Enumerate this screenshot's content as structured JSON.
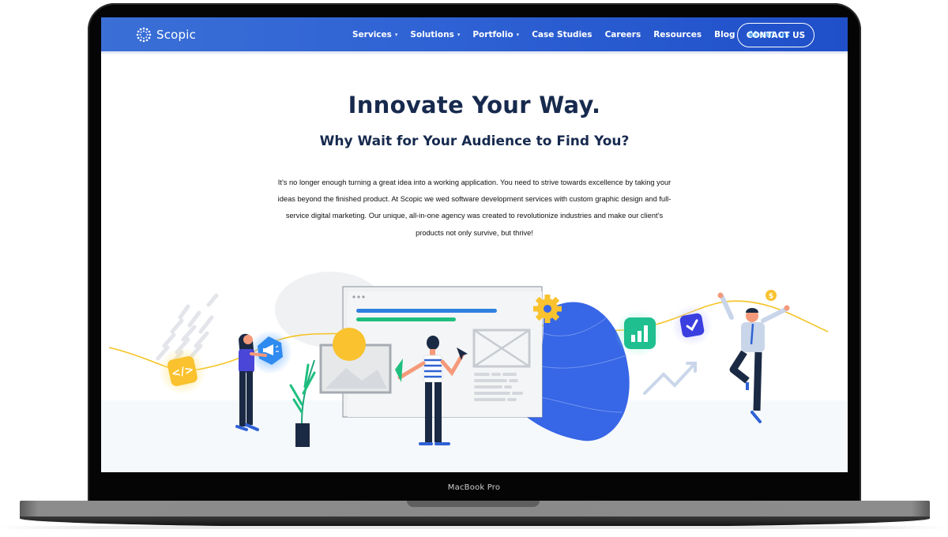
{
  "device": {
    "model_label": "MacBook Pro"
  },
  "navbar": {
    "brand": "Scopic",
    "items": [
      {
        "label": "Services",
        "has_dropdown": true,
        "chevron": "▾"
      },
      {
        "label": "Solutions",
        "has_dropdown": true,
        "chevron": "▾"
      },
      {
        "label": "Portfolio",
        "has_dropdown": true,
        "chevron": "▾"
      },
      {
        "label": "Case Studies",
        "has_dropdown": false
      },
      {
        "label": "Careers",
        "has_dropdown": false
      },
      {
        "label": "Resources",
        "has_dropdown": false
      },
      {
        "label": "Blog",
        "has_dropdown": false
      },
      {
        "label": "About us",
        "has_dropdown": false,
        "active": true
      }
    ],
    "cta_label": "CONTACT US",
    "colors": {
      "bar": "#2f62d4",
      "active_link": "#7fd0ff"
    }
  },
  "hero": {
    "title": "Innovate Your Way.",
    "subtitle": "Why Wait for Your Audience to Find You?",
    "body": "It’s no longer enough turning a great idea into a working application. You need to strive towards excellence by taking your ideas beyond the finished product. At Scopic we wed software development services with custom graphic design and full-service digital marketing. Our unique, all-in-one agency was created to revolutionize industries and make our client’s products not only survive, but thrive!"
  },
  "illustration": {
    "icons": [
      "code-icon",
      "megaphone-icon",
      "gear-icon",
      "bar-chart-icon",
      "checkmark-icon",
      "dollar-coin-icon",
      "trend-arrow-icon",
      "cursor-icon"
    ],
    "colors": {
      "yellow": "#f9c22e",
      "blue": "#2f8bf0",
      "green": "#1fbf8f",
      "indigo": "#3b3fe0",
      "blob": "#3766e6",
      "navy": "#172a4e"
    }
  }
}
